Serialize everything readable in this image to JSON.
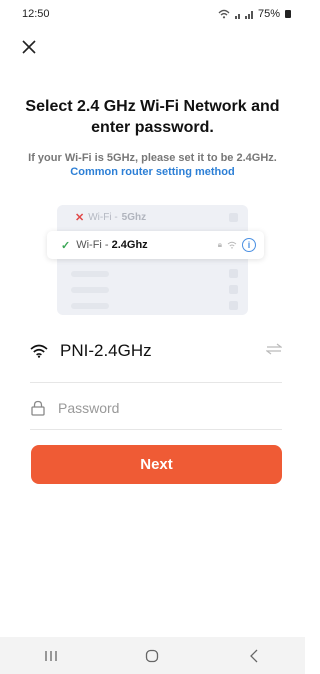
{
  "status_bar": {
    "time": "12:50",
    "signal_text": "⋅•••",
    "battery_text": "75%"
  },
  "header": {
    "title": "Select 2.4 GHz Wi-Fi Network and enter password.",
    "note_prefix": "If your Wi-Fi is 5GHz, please set it to be 2.4GHz.",
    "note_link": "Common router setting method"
  },
  "illustration": {
    "row_bad_prefix": "Wi-Fi - ",
    "row_bad_band": "5Ghz",
    "row_good_prefix": "Wi-Fi - ",
    "row_good_band": "2.4Ghz"
  },
  "form": {
    "network_name": "PNI-2.4GHz",
    "password_placeholder": "Password",
    "next_label": "Next"
  },
  "colors": {
    "accent": "#ef5b35",
    "link": "#2c7fd6"
  }
}
